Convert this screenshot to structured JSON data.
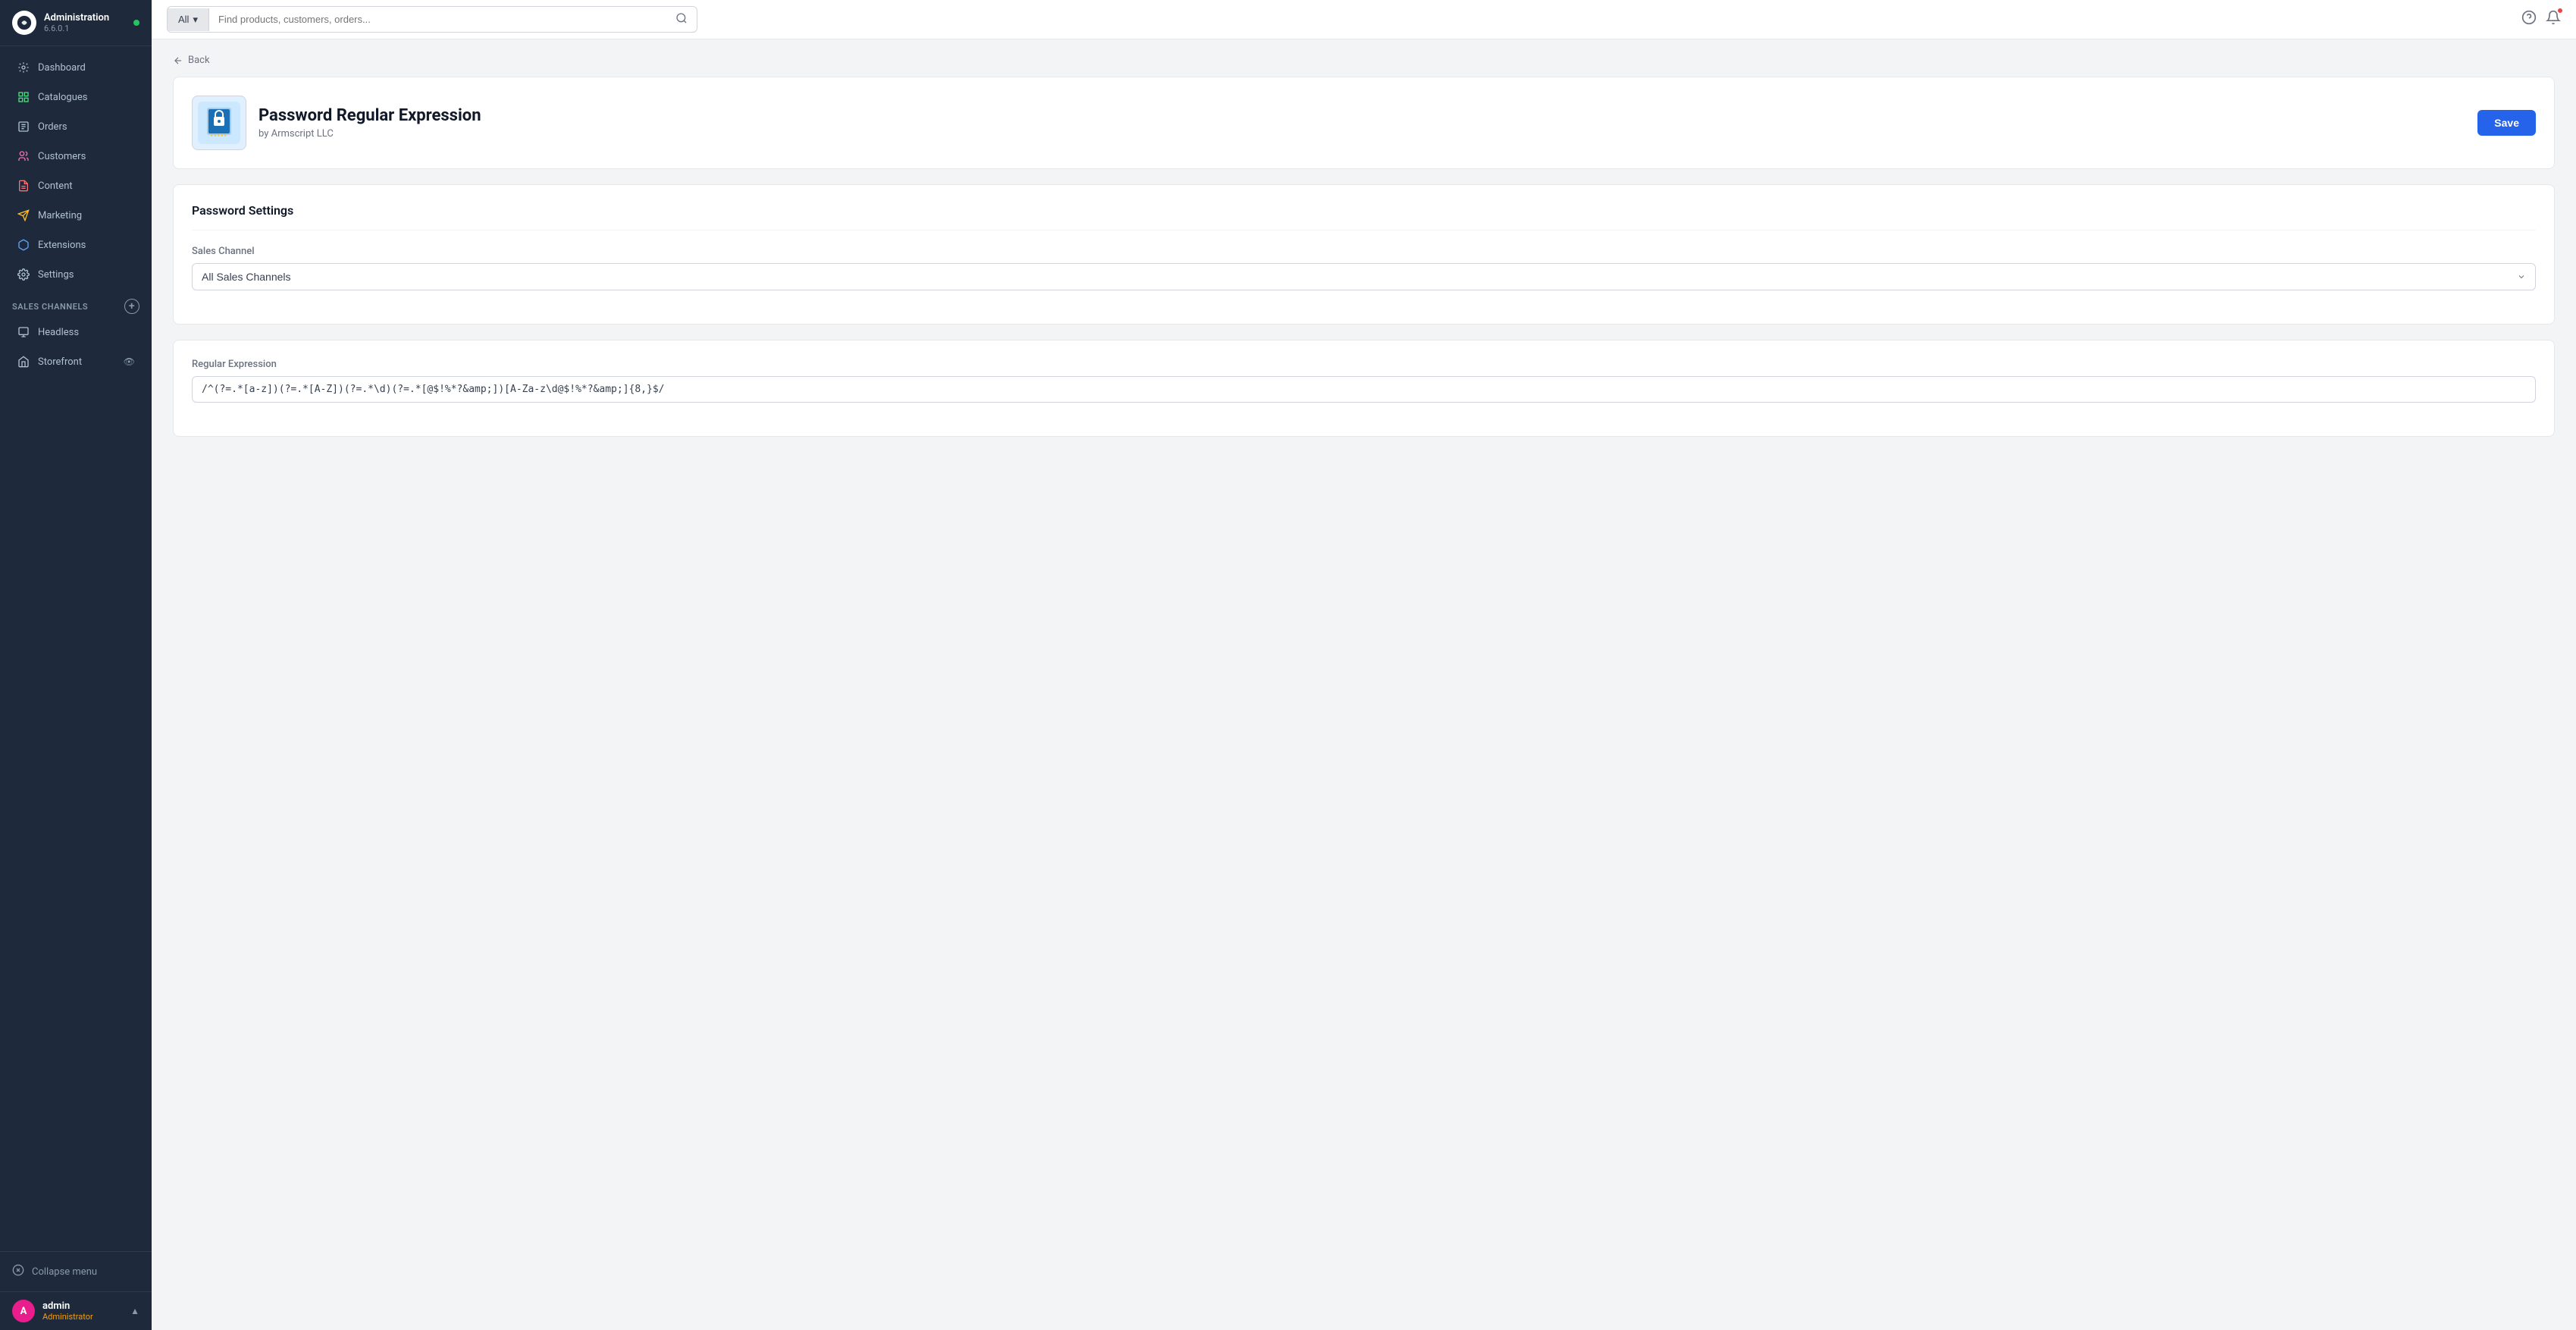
{
  "app": {
    "name": "Administration",
    "version": "6.6.0.1",
    "online": true
  },
  "sidebar": {
    "nav_items": [
      {
        "id": "dashboard",
        "label": "Dashboard",
        "icon": "dashboard-icon"
      },
      {
        "id": "catalogues",
        "label": "Catalogues",
        "icon": "catalogues-icon"
      },
      {
        "id": "orders",
        "label": "Orders",
        "icon": "orders-icon"
      },
      {
        "id": "customers",
        "label": "Customers",
        "icon": "customers-icon"
      },
      {
        "id": "content",
        "label": "Content",
        "icon": "content-icon"
      },
      {
        "id": "marketing",
        "label": "Marketing",
        "icon": "marketing-icon"
      },
      {
        "id": "extensions",
        "label": "Extensions",
        "icon": "extensions-icon"
      },
      {
        "id": "settings",
        "label": "Settings",
        "icon": "settings-icon"
      }
    ],
    "sales_channels_label": "Sales Channels",
    "sales_channel_items": [
      {
        "id": "headless",
        "label": "Headless",
        "icon": "headless-icon"
      },
      {
        "id": "storefront",
        "label": "Storefront",
        "icon": "storefront-icon"
      }
    ],
    "collapse_label": "Collapse menu",
    "user": {
      "initial": "A",
      "name": "admin",
      "role": "Administrator"
    }
  },
  "topbar": {
    "search_all_label": "All",
    "search_placeholder": "Find products, customers, orders...",
    "chevron_down": "▾"
  },
  "back_label": "Back",
  "plugin": {
    "name": "Password Regular Expression",
    "by": "by Armscript LLC",
    "save_label": "Save"
  },
  "password_settings": {
    "section_title": "Password Settings",
    "sales_channel_label": "Sales Channel",
    "sales_channel_value": "All Sales Channels",
    "sales_channel_options": [
      "All Sales Channels"
    ],
    "regex_label": "Regular Expression",
    "regex_value": "/^(?=.*[a-z])(?=.*[A-Z])(?=.*\\d)(?=.*[@$!%*?&amp;])[A-Za-z\\d@$!%*?&amp;]{8,}$/"
  }
}
